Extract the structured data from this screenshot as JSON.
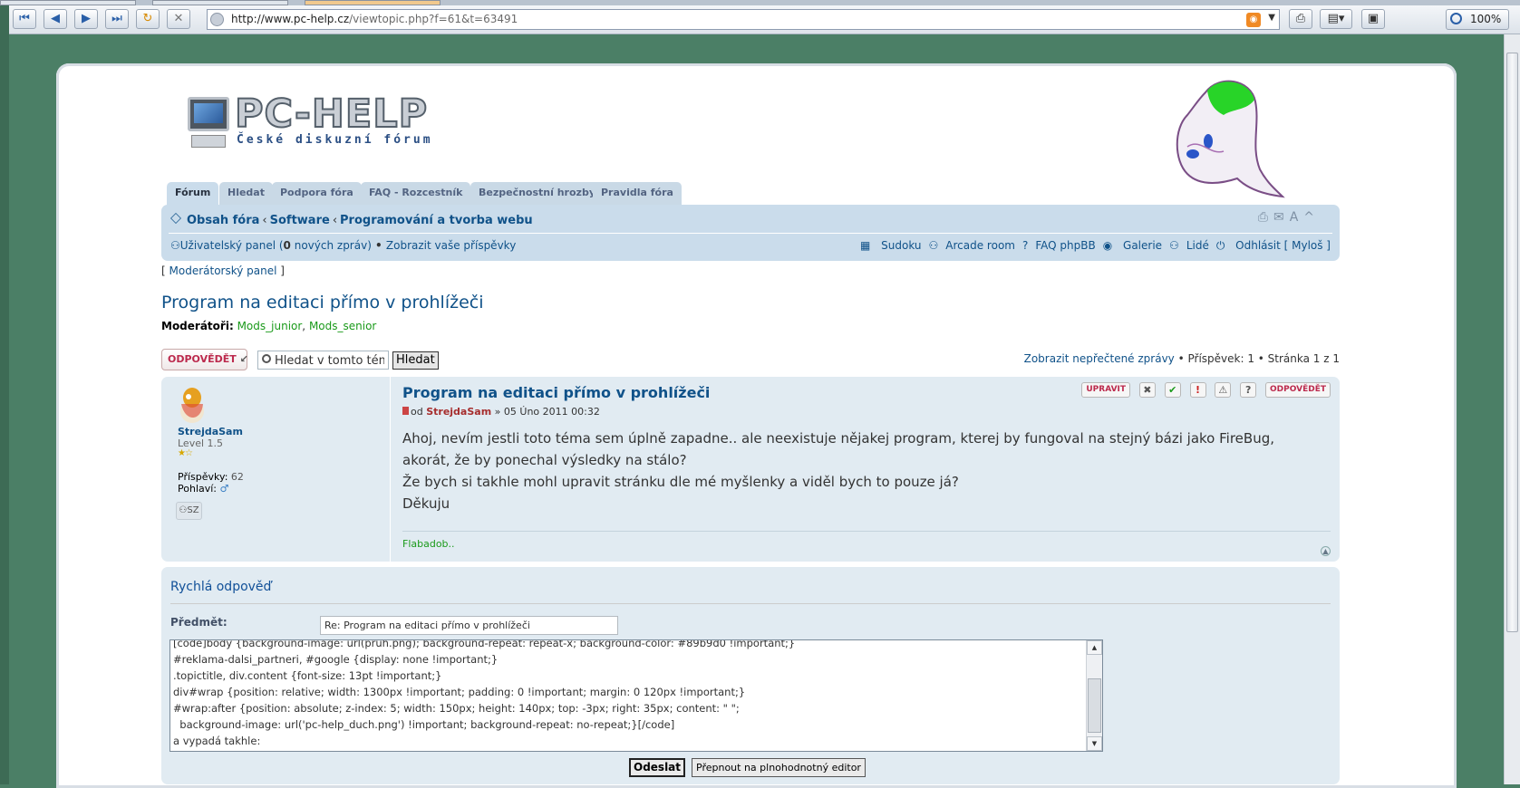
{
  "browser": {
    "url_host": "http://www.pc-help.cz",
    "url_path": "/viewtopic.php?f=61&t=63491",
    "zoom": "100%"
  },
  "logo": {
    "title": "PC-HELP",
    "subtitle": "České diskuzní fórum"
  },
  "tabs": [
    "Fórum",
    "Hledat",
    "Podpora fóra",
    "FAQ - Rozcestník",
    "Bezpečnostní hrozby",
    "Pravidla fóra"
  ],
  "breadcrumbs": [
    "Obsah fóra",
    "Software",
    "Programování a tvorba webu"
  ],
  "navbar": {
    "user_panel": "Uživatelský panel (",
    "new_count": "0",
    "new_label": " nových zpráv)",
    "sep": " • ",
    "own_posts": "Zobrazit vaše příspěvky",
    "links": [
      "Sudoku",
      "Arcade room",
      "FAQ phpBB",
      "Galerie",
      "Lidé",
      "Odhlásit [ Myloš ]"
    ]
  },
  "mod_panel": "Moderátorský panel",
  "topic": {
    "title": "Program na editaci přímo v prohlížeči",
    "moderators_label": "Moderátoři:",
    "moderators": [
      "Mods_junior",
      "Mods_senior"
    ]
  },
  "actionbar": {
    "reply": "ODPOVĚDĚT",
    "search_value": "Hledat v tomto téma",
    "search_button": "Hledat",
    "unread": "Zobrazit nepřečtené zprávy",
    "post_count": " • Příspěvek: 1 • Stránka ",
    "page": "1",
    "page_of": " z 1"
  },
  "post": {
    "author": "StrejdaSam",
    "level": "Level 1.5",
    "posts_label": "Příspěvky:",
    "posts_value": "62",
    "gender_label": "Pohlaví:",
    "contact_label": "SZ",
    "title": "Program na editaci přímo v prohlížeči",
    "byline_prefix": "od ",
    "byline_date": " » 05 Úno 2011 00:32",
    "body": [
      "Ahoj, nevím jestli toto téma sem úplně zapadne.. ale neexistuje nějakej program, kterej by fungoval na stejný bázi jako FireBug,",
      "akorát, že by ponechal výsledky na stálo?",
      "Že bych si takhle mohl upravit stránku dle mé myšlenky a viděl bych to pouze já?",
      "Děkuju"
    ],
    "signature": "Flabadob..",
    "edit_label": "UPRAVIT",
    "quote_label": "ODPOVĚDĚT"
  },
  "quick_reply": {
    "title": "Rychlá odpověď",
    "subject_label": "Předmět:",
    "subject_value": "Re: Program na editaci přímo v prohlížeči",
    "lines": [
      "[code]body {background-image: url(pruh.png); background-repeat: repeat-x; background-color: #89b9d0 !important;}",
      "#reklama-dalsi_partneri, #google {display: none !important;}",
      ".topictitle, div.content {font-size: 13pt !important;}",
      "div#wrap {position: relative; width: 1300px !important; padding: 0 !important; margin: 0 120px !important;}",
      "#wrap:after {position: absolute; z-index: 5; width: 150px; height: 140px; top: -3px; right: 35px; content: \" \";",
      "  background-image: url('pc-help_duch.png') !important; background-repeat: no-repeat;}[/code]",
      "a vypadá takhle:"
    ],
    "send": "Odeslat",
    "full_editor": "Přepnout na plnohodnotný editor"
  }
}
